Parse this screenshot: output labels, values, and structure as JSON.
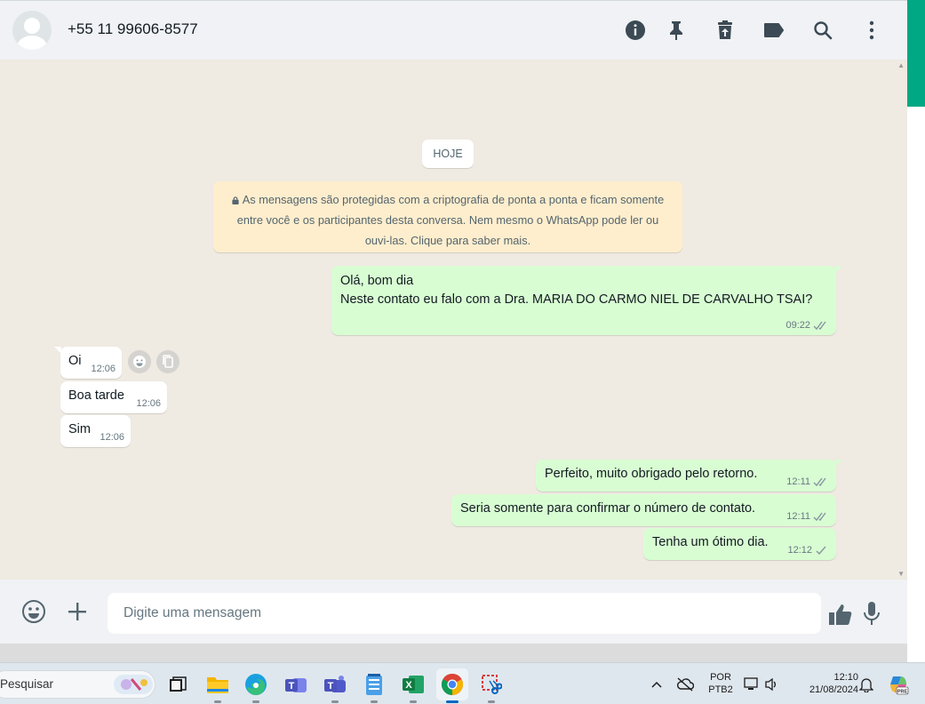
{
  "header": {
    "contact_name": "+55 11 99606-8577",
    "icons": [
      "info-icon",
      "pin-icon",
      "archive-icon",
      "label-icon",
      "search-icon",
      "menu-icon"
    ]
  },
  "chat": {
    "day_label": "HOJE",
    "encryption_notice": "As mensagens são protegidas com a criptografia de ponta a ponta e ficam somente entre você e os participantes desta conversa. Nem mesmo o WhatsApp pode ler ou ouvi-las. Clique para saber mais.",
    "messages": [
      {
        "dir": "out",
        "lines": [
          "Olá, bom dia",
          "Neste contato eu falo com a Dra. MARIA DO CARMO NIEL DE CARVALHO TSAI?"
        ],
        "time": "09:22",
        "status": "read"
      },
      {
        "dir": "in",
        "lines": [
          "Oi"
        ],
        "time": "12:06"
      },
      {
        "dir": "in",
        "lines": [
          "Boa tarde"
        ],
        "time": "12:06"
      },
      {
        "dir": "in",
        "lines": [
          "Sim"
        ],
        "time": "12:06"
      },
      {
        "dir": "out",
        "lines": [
          "Perfeito, muito obrigado pelo retorno."
        ],
        "time": "12:11",
        "status": "read"
      },
      {
        "dir": "out",
        "lines": [
          "Seria somente para confirmar o número de contato."
        ],
        "time": "12:11",
        "status": "read"
      },
      {
        "dir": "out",
        "lines": [
          "Tenha um ótimo dia."
        ],
        "time": "12:12",
        "status": "sent"
      }
    ]
  },
  "composer": {
    "placeholder": "Digite uma mensagem"
  },
  "taskbar": {
    "search_label": "Pesquisar",
    "apps": [
      "task-view",
      "file-explorer",
      "edge",
      "teams-work",
      "teams",
      "notepad",
      "excel",
      "chrome",
      "snipping-tool"
    ],
    "language_line1": "POR",
    "language_line2": "PTB2",
    "time": "12:10",
    "date": "21/08/2024"
  },
  "colors": {
    "outgoing_bubble": "#d9fdd3",
    "incoming_bubble": "#ffffff",
    "accent": "#00a884",
    "chat_background": "#efeae2",
    "notice_background": "#ffeecd"
  }
}
